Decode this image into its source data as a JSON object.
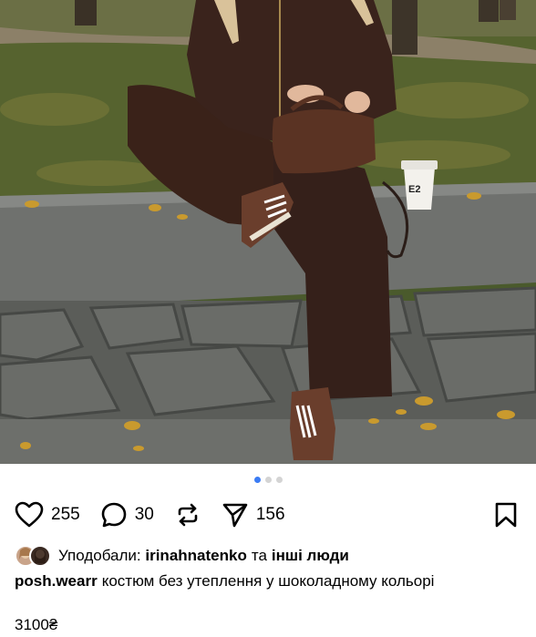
{
  "post": {
    "image_alt_subject": "",
    "carousel": {
      "total": 3,
      "active": 1
    }
  },
  "actions": {
    "like_count": "255",
    "comment_count": "30",
    "share_count": "156"
  },
  "likes": {
    "prefix": "Уподобали:",
    "user": "irinahnatenko",
    "conjunction": "та",
    "others": "інші люди"
  },
  "caption": {
    "username": "posh.wearr",
    "text": "костюм без утеплення у шоколадному кольорі",
    "price": "3100₴"
  },
  "photo": {
    "cup_label": "E2"
  },
  "icons": {
    "like": "heart-icon",
    "comment": "comment-bubble-icon",
    "repost": "repost-icon",
    "share": "send-icon",
    "save": "bookmark-icon"
  }
}
